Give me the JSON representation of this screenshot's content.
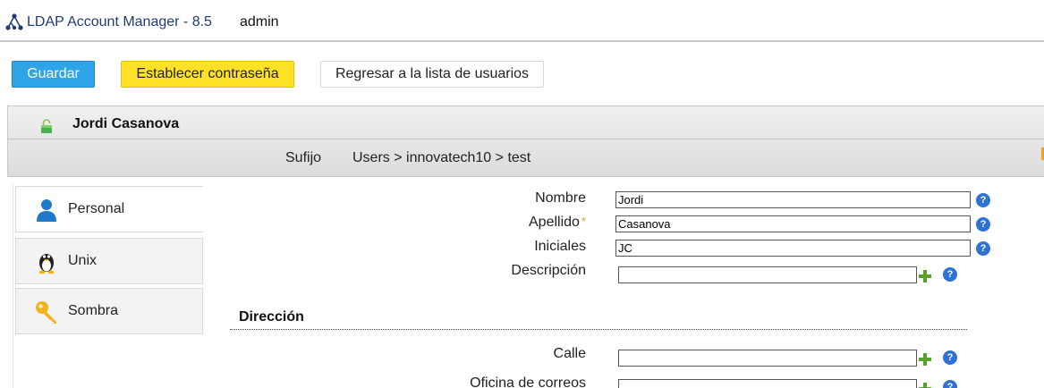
{
  "header": {
    "app_title": "LDAP Account Manager - 8.5",
    "user": "admin",
    "logo_icon": "tree-network-icon"
  },
  "toolbar": {
    "save_label": "Guardar",
    "set_password_label": "Establecer contraseña",
    "back_label": "Regresar a la lista de usuarios"
  },
  "account": {
    "name": "Jordi Casanova",
    "status_icon": "unlocked-green-lock-icon",
    "suffix_label": "Sufijo",
    "suffix_value": "Users > innovatech10 > test"
  },
  "sidebar": {
    "tabs": [
      {
        "label": "Personal",
        "icon": "person-icon",
        "active": true
      },
      {
        "label": "Unix",
        "icon": "penguin-icon",
        "active": false
      },
      {
        "label": "Sombra",
        "icon": "key-icon",
        "active": false
      }
    ]
  },
  "form": {
    "fields": [
      {
        "label": "Nombre",
        "value": "Jordi",
        "required": false
      },
      {
        "label": "Apellido",
        "value": "Casanova",
        "required": true,
        "required_mark": "*"
      },
      {
        "label": "Iniciales",
        "value": "JC",
        "required": false
      },
      {
        "label": "Descripción",
        "value": "",
        "required": false
      }
    ],
    "address_section": {
      "title": "Dirección",
      "fields": [
        {
          "label": "Calle",
          "value": ""
        },
        {
          "label": "Oficina de correos",
          "value": ""
        }
      ]
    },
    "help_glyph": "?"
  },
  "colors": {
    "save_button": "#2fa4e7",
    "password_button": "#ffe228",
    "help_icon": "#2e72d6",
    "add_icon": "#5aa02c",
    "title_text": "#1f3b78"
  }
}
